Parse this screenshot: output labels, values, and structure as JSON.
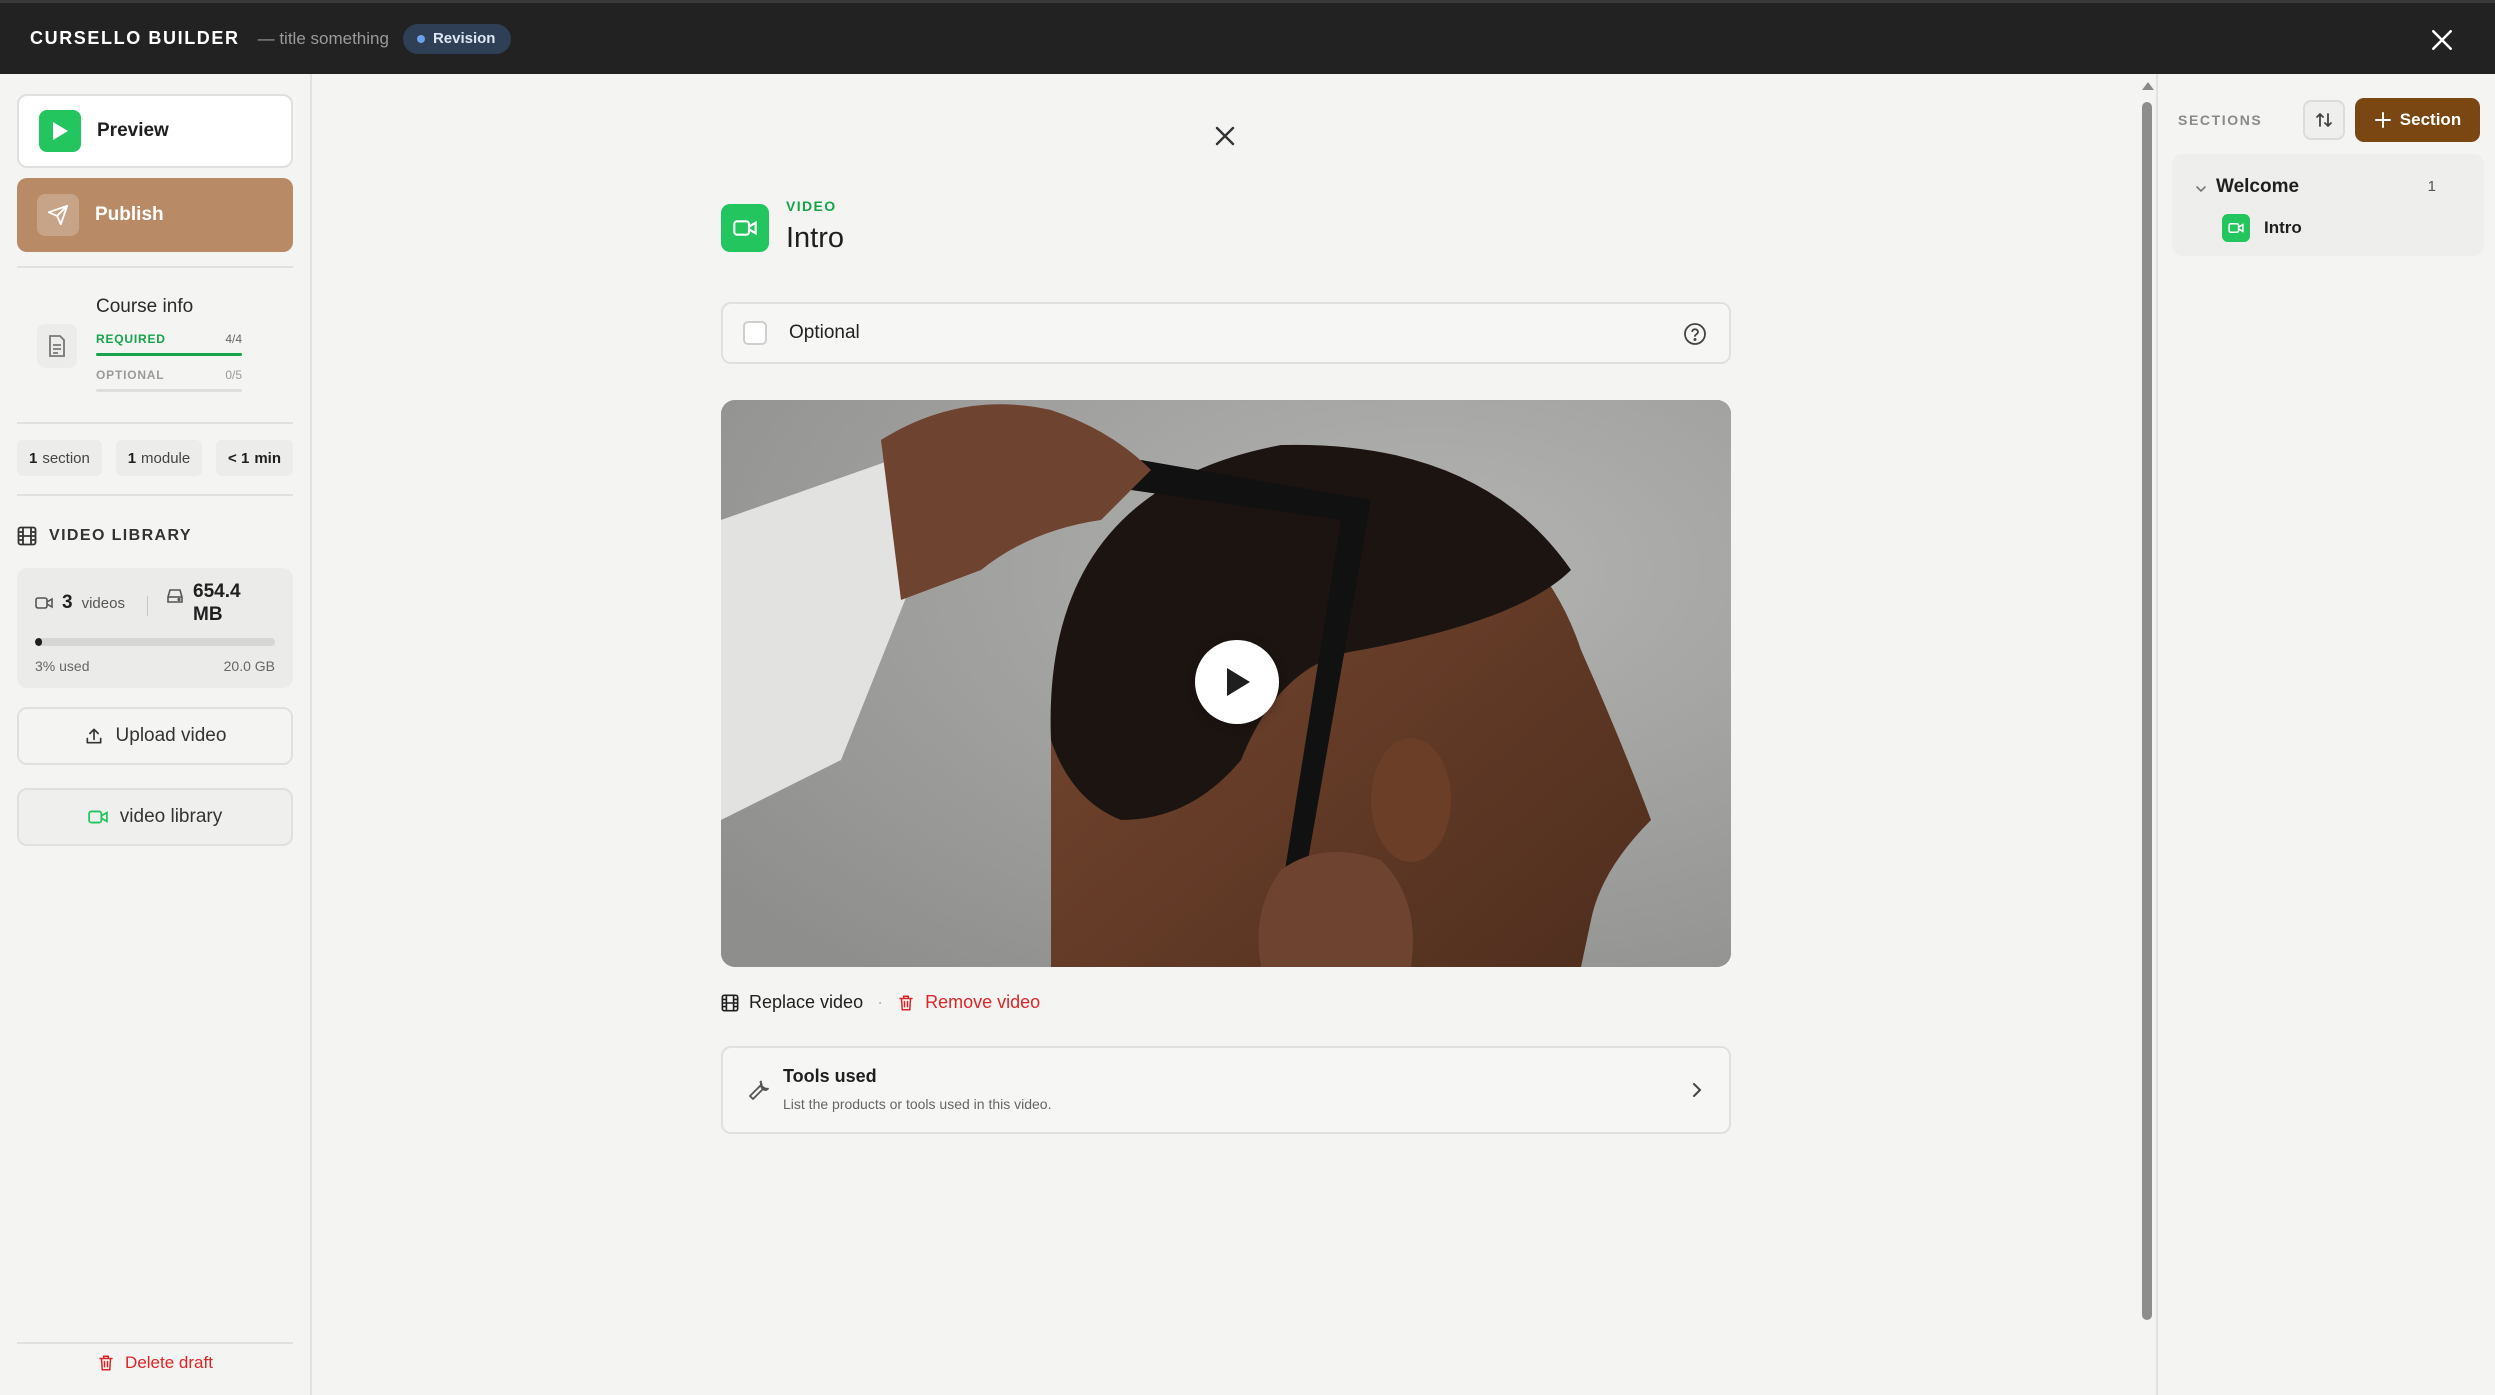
{
  "topbar": {
    "brand": "CURSELLO BUILDER",
    "subtitle": "— title something",
    "badge": "Revision",
    "badge_dot_color": "#6aa2ee"
  },
  "sidebar": {
    "preview_label": "Preview",
    "publish_label": "Publish",
    "course_info": {
      "title": "Course info",
      "required_label": "REQUIRED",
      "required_value": "4/4",
      "optional_label": "OPTIONAL",
      "optional_value": "0/5"
    },
    "stats": [
      {
        "count": "1",
        "label": "section"
      },
      {
        "count": "1",
        "label": "module"
      },
      {
        "count": "< 1",
        "label": "min"
      }
    ],
    "video_library": {
      "heading": "VIDEO LIBRARY",
      "video_count": "3",
      "video_label": "videos",
      "size": "654.4 MB",
      "used_label": "3% used",
      "used_fraction": 0.03,
      "capacity": "20.0 GB"
    },
    "upload_label": "Upload video",
    "library_label": "video library",
    "delete_label": "Delete draft"
  },
  "editor": {
    "type_label": "VIDEO",
    "title": "Intro",
    "optional_label": "Optional",
    "replace_label": "Replace video",
    "remove_label": "Remove video",
    "tools_title": "Tools used",
    "tools_desc": "List the products or tools used in this video."
  },
  "right_panel": {
    "sections_label": "SECTIONS",
    "add_section_label": "Section",
    "sections": [
      {
        "title": "Welcome",
        "count": "1",
        "modules": [
          {
            "title": "Intro"
          }
        ]
      }
    ]
  },
  "colors": {
    "accent_green": "#22c55e",
    "publish": "#b88a66",
    "add_section": "#7a4712",
    "danger": "#dc2626"
  },
  "icons": {
    "preview": "play-icon",
    "publish": "send-icon",
    "course_info": "document-icon",
    "library": "film-icon",
    "upload": "upload-icon",
    "delete": "trash-icon",
    "close": "close-icon",
    "help": "help-circle-icon",
    "tools": "wrench-icon"
  }
}
